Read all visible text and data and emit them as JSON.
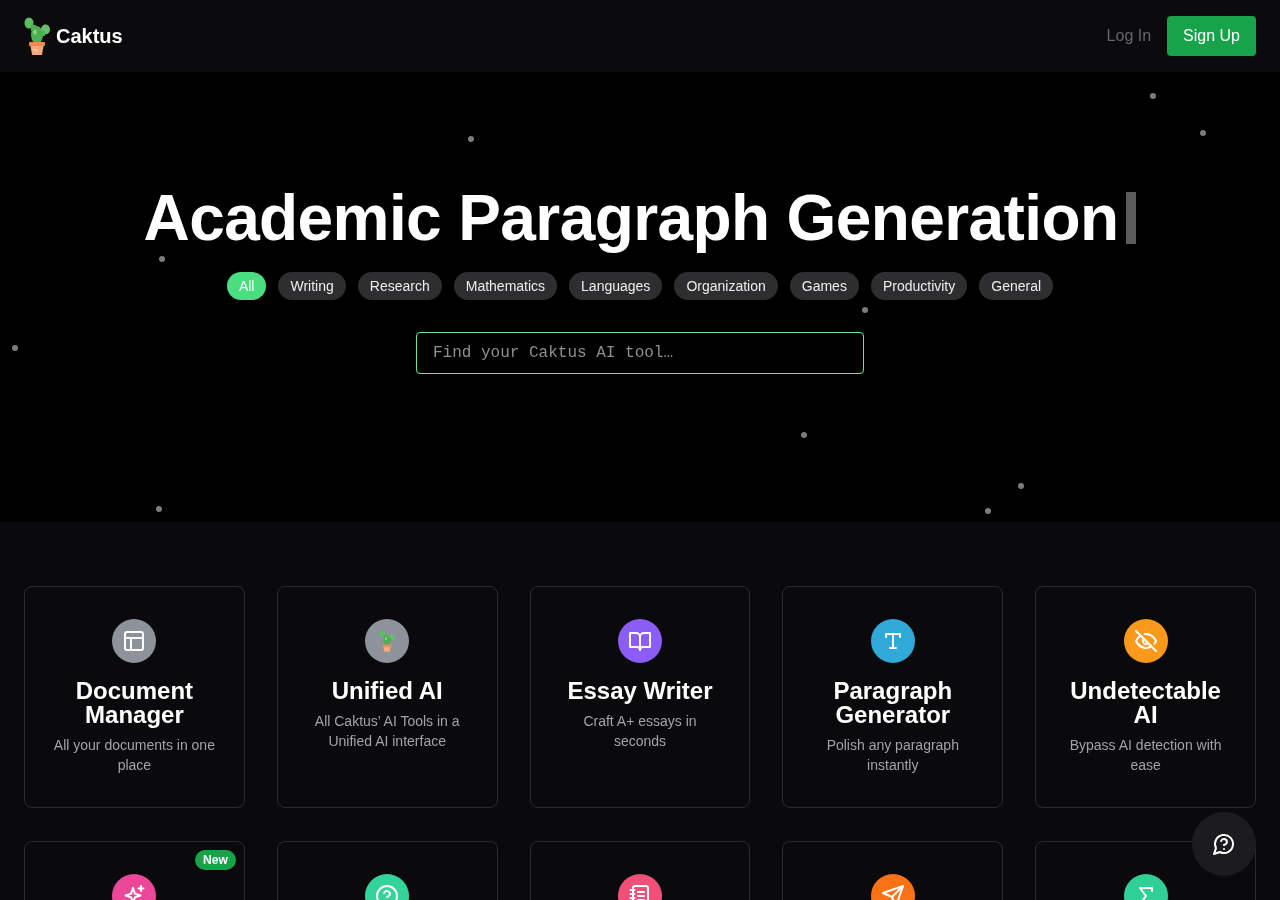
{
  "header": {
    "brand": "Caktus",
    "login": "Log In",
    "signup": "Sign Up"
  },
  "hero": {
    "title": "Academic Paragraph Generation",
    "categories": [
      {
        "label": "All",
        "selected": true
      },
      {
        "label": "Writing",
        "selected": false
      },
      {
        "label": "Research",
        "selected": false
      },
      {
        "label": "Mathematics",
        "selected": false
      },
      {
        "label": "Languages",
        "selected": false
      },
      {
        "label": "Organization",
        "selected": false
      },
      {
        "label": "Games",
        "selected": false
      },
      {
        "label": "Productivity",
        "selected": false
      },
      {
        "label": "General",
        "selected": false
      }
    ],
    "search": {
      "placeholder": "Find your Caktus AI tool…"
    }
  },
  "tools": [
    {
      "title": "Document Manager",
      "description": "All your documents in one place",
      "color": "#8e939b"
    },
    {
      "title": "Unified AI",
      "description": "All Caktus’ AI Tools in a Unified AI interface",
      "color": "#8e939b"
    },
    {
      "title": "Essay Writer",
      "description": "Craft A+ essays in seconds",
      "color": "#8b5cf6"
    },
    {
      "title": "Paragraph Generator",
      "description": "Polish any paragraph instantly",
      "color": "#31a9d8"
    },
    {
      "title": "Undetectable AI",
      "description": "Bypass AI detection with ease",
      "color": "#fb9a1a"
    },
    {
      "badge": "New",
      "color": "#ec4899"
    },
    {
      "color": "#34d399"
    },
    {
      "color": "#f05078"
    },
    {
      "color": "#f97316"
    },
    {
      "color": "#2fcf95"
    }
  ]
}
